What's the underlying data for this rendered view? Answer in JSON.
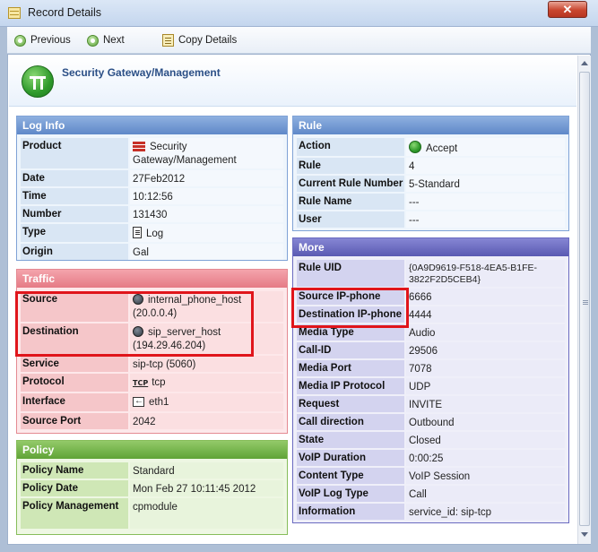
{
  "window": {
    "title": "Record Details",
    "close_label": "✕"
  },
  "toolbar": {
    "previous_label": "Previous",
    "next_label": "Next",
    "copy_label": "Copy Details"
  },
  "header": {
    "title": "Security Gateway/Management"
  },
  "log_info": {
    "title": "Log Info",
    "rows": [
      {
        "key": "Product",
        "value": "Security Gateway/Management",
        "icon": "firewall-icon"
      },
      {
        "key": "Date",
        "value": "27Feb2012"
      },
      {
        "key": "Time",
        "value": "10:12:56"
      },
      {
        "key": "Number",
        "value": "131430"
      },
      {
        "key": "Type",
        "value": "Log",
        "icon": "log-document-icon"
      },
      {
        "key": "Origin",
        "value": "Gal"
      }
    ]
  },
  "traffic": {
    "title": "Traffic",
    "rows": [
      {
        "key": "Source",
        "value": "internal_phone_host",
        "sub": "(20.0.0.4)",
        "icon": "host-icon"
      },
      {
        "key": "Destination",
        "value": "sip_server_host",
        "sub": "(194.29.46.204)",
        "icon": "host-icon"
      },
      {
        "key": "Service",
        "value": "sip-tcp (5060)"
      },
      {
        "key": "Protocol",
        "value": "tcp",
        "icon_text": "TCP"
      },
      {
        "key": "Interface",
        "value": "eth1",
        "icon": "interface-icon"
      },
      {
        "key": "Source Port",
        "value": "2042"
      }
    ]
  },
  "policy": {
    "title": "Policy",
    "rows": [
      {
        "key": "Policy Name",
        "value": "Standard"
      },
      {
        "key": "Policy Date",
        "value": "Mon Feb 27 10:11:45 2012"
      },
      {
        "key": "Policy Management",
        "value": "cpmodule"
      }
    ]
  },
  "rule": {
    "title": "Rule",
    "rows": [
      {
        "key": "Action",
        "value": "Accept",
        "icon": "accept-icon"
      },
      {
        "key": "Rule",
        "value": "4"
      },
      {
        "key": "Current Rule Number",
        "value": "5-Standard"
      },
      {
        "key": "Rule Name",
        "value": "---"
      },
      {
        "key": "User",
        "value": "---"
      }
    ]
  },
  "more": {
    "title": "More",
    "rows": [
      {
        "key": "Rule UID",
        "value": "{0A9D9619-F518-4EA5-B1FE-",
        "sub": "3822F2D5CEB4}"
      },
      {
        "key": "Source IP-phone",
        "value": "6666"
      },
      {
        "key": "Destination IP-phone",
        "value": "4444"
      },
      {
        "key": "Media Type",
        "value": "Audio"
      },
      {
        "key": "Call-ID",
        "value": "29506"
      },
      {
        "key": "Media Port",
        "value": "7078"
      },
      {
        "key": "Media IP Protocol",
        "value": "UDP"
      },
      {
        "key": "Request",
        "value": "INVITE"
      },
      {
        "key": "Call direction",
        "value": "Outbound"
      },
      {
        "key": "State",
        "value": "Closed"
      },
      {
        "key": "VoIP Duration",
        "value": "0:00:25"
      },
      {
        "key": "Content Type",
        "value": "VoIP Session"
      },
      {
        "key": "VoIP Log Type",
        "value": "Call"
      },
      {
        "key": "Information",
        "value": "service_id: sip-tcp"
      }
    ]
  },
  "colors": {
    "highlight": "#e0151b",
    "log_head": "#5f88c8",
    "traffic_head": "#e57a85",
    "policy_head": "#5fa336",
    "more_head": "#5a5ab2"
  }
}
